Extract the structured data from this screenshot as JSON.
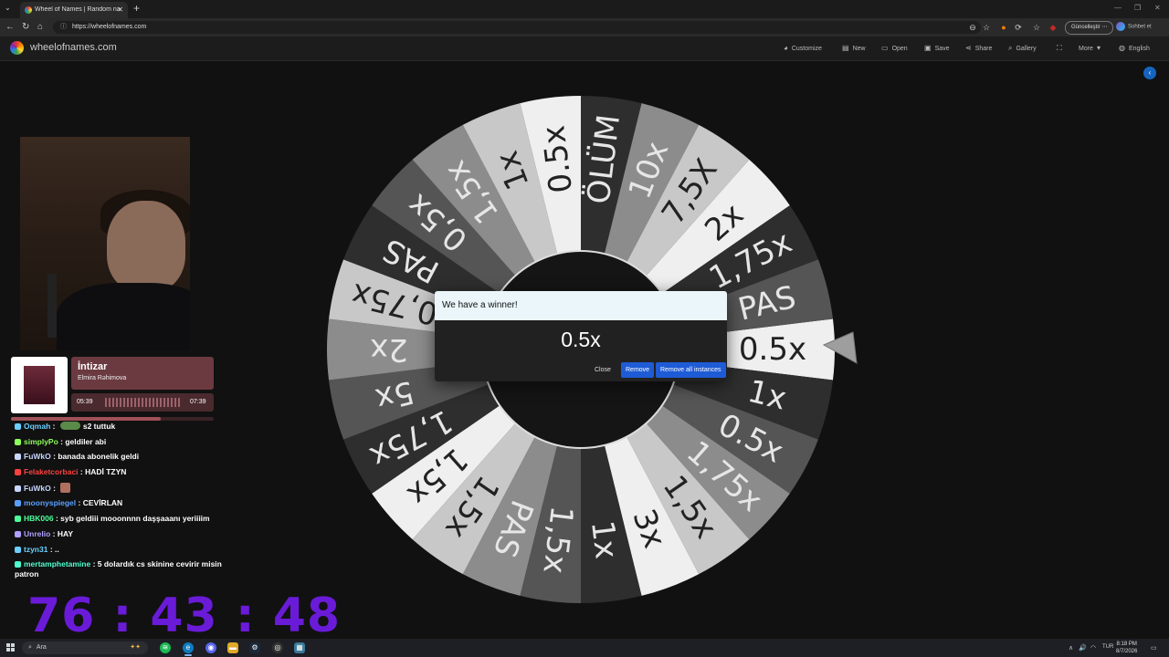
{
  "browser": {
    "tab_title": "Wheel of Names | Random name",
    "url": "https://wheelofnames.com",
    "update_label": "Güncelleştir",
    "chat_label": "Sohbet et"
  },
  "site": {
    "logo_text": "wheelofnames.com",
    "menu": [
      {
        "label": "Customize",
        "icon": "palette-icon"
      },
      {
        "label": "New",
        "icon": "new-file-icon"
      },
      {
        "label": "Open",
        "icon": "folder-icon"
      },
      {
        "label": "Save",
        "icon": "save-icon"
      },
      {
        "label": "Share",
        "icon": "share-icon"
      },
      {
        "label": "Gallery",
        "icon": "search-icon"
      },
      {
        "label": "",
        "icon": "fullscreen-icon"
      },
      {
        "label": "More",
        "icon": "chevron-down-icon"
      },
      {
        "label": "English",
        "icon": "globe-icon"
      }
    ]
  },
  "wheel": {
    "segments": [
      {
        "label": "0.5x",
        "color": "#efefef"
      },
      {
        "label": "1x",
        "color": "#2e2e2e"
      },
      {
        "label": "0.5x",
        "color": "#555555"
      },
      {
        "label": "1,75x",
        "color": "#8c8c8c"
      },
      {
        "label": "1,5x",
        "color": "#c8c8c8"
      },
      {
        "label": "3x",
        "color": "#efefef"
      },
      {
        "label": "1x",
        "color": "#2e2e2e"
      },
      {
        "label": "1,5x",
        "color": "#555555"
      },
      {
        "label": "PAS",
        "color": "#8c8c8c"
      },
      {
        "label": "1,5x",
        "color": "#c8c8c8"
      },
      {
        "label": "1,5x",
        "color": "#efefef"
      },
      {
        "label": "1,75x",
        "color": "#2e2e2e"
      },
      {
        "label": "5x",
        "color": "#555555"
      },
      {
        "label": "2x",
        "color": "#8c8c8c"
      },
      {
        "label": "0,75x",
        "color": "#c8c8c8"
      },
      {
        "label": "PAS",
        "color": "#2e2e2e"
      },
      {
        "label": "0,5x",
        "color": "#555555"
      },
      {
        "label": "1,5x",
        "color": "#8c8c8c"
      },
      {
        "label": "1x",
        "color": "#c8c8c8"
      },
      {
        "label": "0.5x",
        "color": "#efefef"
      },
      {
        "label": "ÖLÜM",
        "color": "#2e2e2e"
      },
      {
        "label": "10x",
        "color": "#8c8c8c"
      },
      {
        "label": "7,5X",
        "color": "#c8c8c8"
      },
      {
        "label": "2x",
        "color": "#efefef"
      },
      {
        "label": "1,75x",
        "color": "#2e2e2e"
      },
      {
        "label": "PAS",
        "color": "#555555"
      }
    ],
    "text_colors": {
      "light": "#222222",
      "dark": "#e6e6e6"
    }
  },
  "modal": {
    "title": "We have a winner!",
    "winner": "0.5x",
    "close_label": "Close",
    "remove_label": "Remove",
    "remove_all_label": "Remove all instances"
  },
  "now_playing": {
    "title": "İntizar",
    "artist": "Elmira Rəhimova",
    "elapsed": "05:39",
    "duration": "07:39",
    "progress": 0.74
  },
  "chat": [
    {
      "user": "Oqmah",
      "color": "#6ad0ff",
      "text": "s2 tuttuk",
      "emote": true
    },
    {
      "user": "simplyPo",
      "color": "#8dff5a",
      "text": "geldiler abi"
    },
    {
      "user": "FuWkO",
      "color": "#c7d7ff",
      "text": "banada abonelik geldi"
    },
    {
      "user": "Felaketcorbaci",
      "color": "#ff4040",
      "text": "HADİ TZYN"
    },
    {
      "user": "FuWkO",
      "color": "#c7d7ff",
      "text": "",
      "emote2": true
    },
    {
      "user": "moonyspiegel",
      "color": "#5aa0ff",
      "text": "CEVİRLAN"
    },
    {
      "user": "HBK006",
      "color": "#4dff9a",
      "text": "syb geldiii mooonnnn daşşaaanı yeriiiim"
    },
    {
      "user": "Unrelio",
      "color": "#b0a0ff",
      "text": "HAY"
    },
    {
      "user": "tzyn31",
      "color": "#6ad0ff",
      "text": ".."
    },
    {
      "user": "mertamphetamine",
      "color": "#4dffd0",
      "text": "5 dolardık cs skinine cevirir misin patron"
    }
  ],
  "timer": "76 : 43 : 48",
  "taskbar": {
    "search_placeholder": "Ara",
    "lang": "TUR",
    "time": "8:18 PM",
    "date": "8/7/2026"
  }
}
